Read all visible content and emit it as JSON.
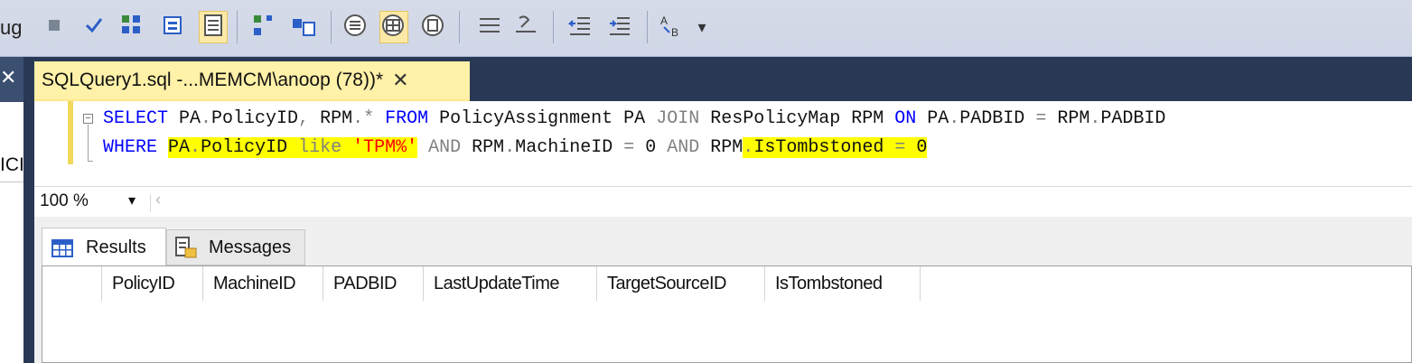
{
  "toolbar": {
    "partial_label": "ug",
    "buttons": [
      {
        "name": "stop-icon",
        "glyph": "■"
      },
      {
        "name": "parse-checkmark-icon",
        "glyph": "✓"
      },
      {
        "name": "display-estimated-plan-icon",
        "glyph": "⛗"
      },
      {
        "name": "query-designer-icon",
        "glyph": "▤"
      },
      {
        "name": "results-to-grid-icon",
        "glyph": "▦"
      },
      {
        "name": "include-actual-plan-icon",
        "glyph": "⇆"
      },
      {
        "name": "live-query-stats-icon",
        "glyph": "▥"
      },
      {
        "name": "results-to-text-icon",
        "glyph": "☷"
      },
      {
        "name": "results-to-grid-active-icon",
        "glyph": "▦"
      },
      {
        "name": "results-to-file-icon",
        "glyph": "☵"
      },
      {
        "name": "comment-lines-icon",
        "glyph": "☰"
      },
      {
        "name": "uncomment-lines-icon",
        "glyph": "☲"
      },
      {
        "name": "decrease-indent-icon",
        "glyph": "⇤"
      },
      {
        "name": "increase-indent-icon",
        "glyph": "⇥"
      },
      {
        "name": "specify-template-values-icon",
        "glyph": "A"
      }
    ],
    "overflow_glyph": "▾"
  },
  "left_panel": {
    "close_glyph": "✕",
    "truncated_text": "ICI"
  },
  "document_tab": {
    "title": "SQLQuery1.sql -...MEMCM\\anoop (78))*",
    "close_glyph": "✕"
  },
  "editor": {
    "line1": {
      "kw_select": "SELECT",
      "t1": " PA",
      "t2": ".",
      "t3": "PolicyID",
      "t4": ",",
      "t5": " RPM",
      "t6": ".*",
      "t7": " ",
      "kw_from": "FROM",
      "t8": " PolicyAssignment PA ",
      "kw_join": "JOIN",
      "t9": " ResPolicyMap RPM ",
      "kw_on": "ON",
      "t10": " PA",
      "t11": ".",
      "t12": "PADBID ",
      "t13": "=",
      "t14": " RPM",
      "t15": ".",
      "t16": "PADBID"
    },
    "line2": {
      "kw_where": "WHERE",
      "t1": " ",
      "t2": "PA",
      "t3": ".",
      "t4": "PolicyID ",
      "t5": "like",
      "t6": " ",
      "str": "'TPM%'",
      "t7": " ",
      "kw_and1": "AND",
      "t8": " RPM",
      "t9": ".",
      "t10": "MachineID ",
      "t11": "=",
      "t12": " 0 ",
      "kw_and2": "AND",
      "t13": " RPM",
      "t14": ".",
      "t15": "IsTombstoned ",
      "t16": "=",
      "t17": " 0"
    }
  },
  "zoom": {
    "value": "100 %",
    "arrow": "▾",
    "scroll_glyph": "‹"
  },
  "results_tabs": [
    {
      "label": "Results",
      "selected": true
    },
    {
      "label": "Messages",
      "selected": false
    }
  ],
  "grid": {
    "columns": [
      "PolicyID",
      "MachineID",
      "PADBID",
      "LastUpdateTime",
      "TargetSourceID",
      "IsTombstoned"
    ],
    "rows": []
  },
  "colors": {
    "keyword": "#0000ff",
    "string": "#ff0000",
    "highlight": "#ffff00",
    "tab_active": "#fff1a8",
    "chrome": "#293955"
  }
}
